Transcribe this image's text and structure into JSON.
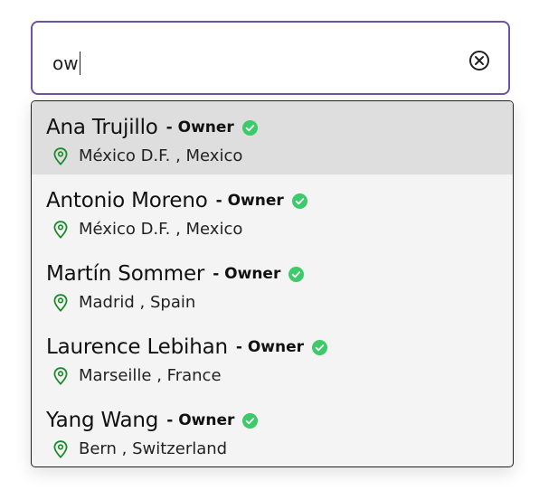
{
  "search": {
    "value": "ow"
  },
  "results": [
    {
      "name": "Ana Trujillo",
      "role": "- Owner",
      "city": "México D.F.",
      "country": "Mexico"
    },
    {
      "name": "Antonio Moreno",
      "role": "- Owner",
      "city": "México D.F.",
      "country": "Mexico"
    },
    {
      "name": "Martín Sommer",
      "role": "- Owner",
      "city": "Madrid",
      "country": "Spain"
    },
    {
      "name": "Laurence Lebihan",
      "role": "- Owner",
      "city": "Marseille",
      "country": "France"
    },
    {
      "name": "Yang Wang",
      "role": "- Owner",
      "city": "Bern",
      "country": "Switzerland"
    }
  ],
  "colors": {
    "border_accent": "#6a55a3",
    "verified": "#3dca6a",
    "pin": "#1a8a2a",
    "highlight": "#dedede"
  },
  "icons": {
    "clear": "close-circle-icon",
    "verified": "check-circle-icon",
    "location": "map-pin-icon"
  }
}
